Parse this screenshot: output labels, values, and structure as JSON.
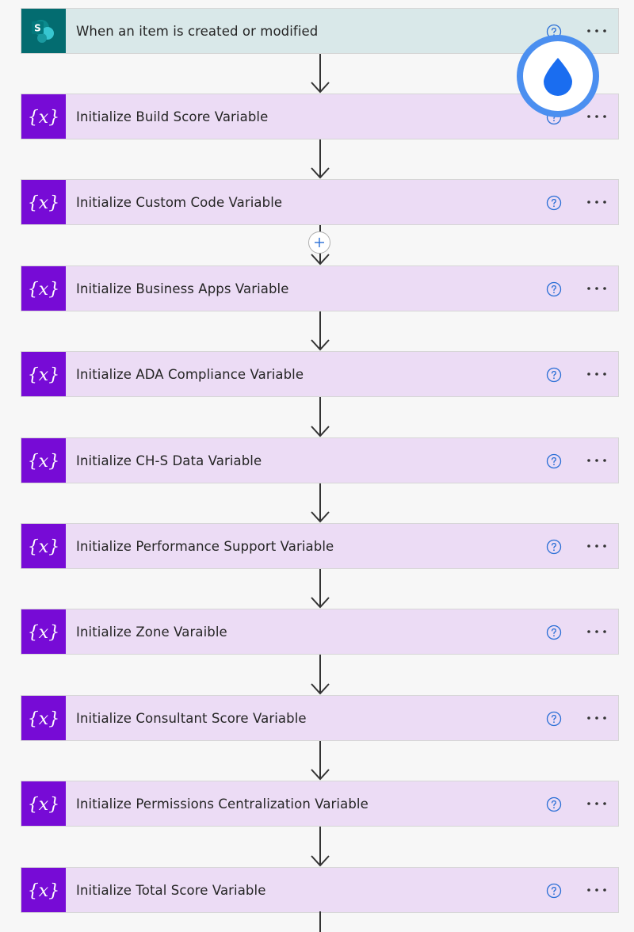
{
  "flow": {
    "trigger": {
      "title": "When an item is created or modified",
      "icon": "sharepoint-icon",
      "color": "#036c70",
      "background": "#d9e8e9"
    },
    "actions": [
      {
        "title": "Initialize Build Score Variable"
      },
      {
        "title": "Initialize Custom Code Variable"
      },
      {
        "title": "Initialize Business Apps Variable"
      },
      {
        "title": "Initialize ADA Compliance Variable"
      },
      {
        "title": "Initialize CH-S Data Variable"
      },
      {
        "title": "Initialize Performance Support Variable"
      },
      {
        "title": "Initialize Zone Varaible"
      },
      {
        "title": "Initialize Consultant Score Variable"
      },
      {
        "title": "Initialize Permissions Centralization Variable"
      },
      {
        "title": "Initialize Total Score Variable"
      }
    ],
    "action_icon": "variable-icon",
    "action_icon_glyph": "{x}",
    "action_color": "#770bd6",
    "action_background": "#ecdcf5",
    "help_icon": "help-icon",
    "more_icon": "more-options-icon",
    "add_step_icon": "add-step-icon",
    "overlay_icon": "water-drop-icon",
    "overlay_color": "#1a6df0"
  },
  "trigger_label": "S"
}
